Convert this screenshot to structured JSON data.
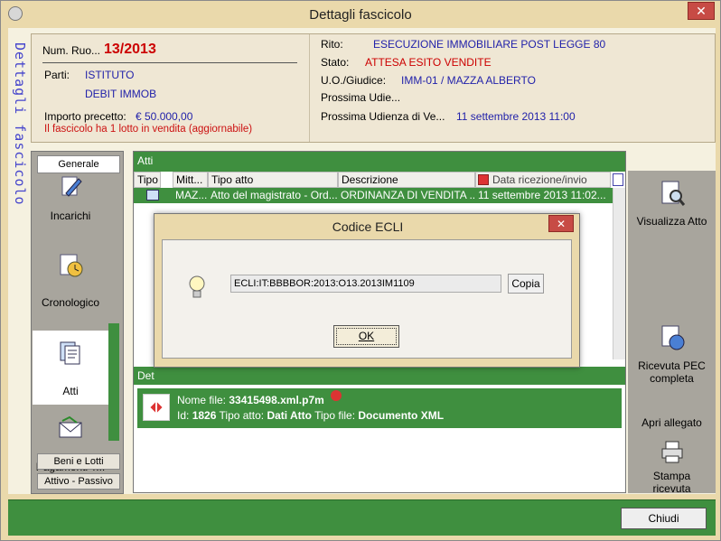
{
  "window": {
    "title": "Dettagli fascicolo",
    "close_glyph": "✕"
  },
  "side_label": "Dettagli fascicolo",
  "header": {
    "num_ruolo_label": "Num. Ruo...",
    "num_ruolo_value": "13/2013",
    "parti_label": "Parti:",
    "parti_line1": "ISTITUTO",
    "parti_line2": "DEBIT IMMOB",
    "importo_label": "Importo precetto:",
    "importo_value": "€ 50.000,00",
    "lotto_note": "Il fascicolo ha 1 lotto in vendita (aggiornabile)",
    "rito_label": "Rito:",
    "rito_value": "ESECUZIONE IMMOBILIARE POST LEGGE 80",
    "stato_label": "Stato:",
    "stato_value": "ATTESA ESITO VENDITE",
    "uo_label": "U.O./Giudice:",
    "uo_value": "IMM-01 / MAZZA ALBERTO",
    "prossima_udie_label": "Prossima Udie...",
    "prossima_udienza_label": "Prossima Udienza di Ve...",
    "prossima_udienza_value": "11 settembre 2013 11:00"
  },
  "left_nav": {
    "tab_generale": "Generale",
    "items": [
      {
        "label": "Incarichi",
        "icon": "pencil-document-icon"
      },
      {
        "label": "Cronologico",
        "icon": "clock-document-icon"
      },
      {
        "label": "Atti",
        "icon": "documents-icon"
      },
      {
        "label": "Pagamenti T...",
        "icon": "envelope-icon"
      }
    ],
    "btn_beni": "Beni e Lotti",
    "btn_attivo": "Attivo - Passivo"
  },
  "atti": {
    "header": "Atti",
    "columns": [
      "Tipo",
      "Mitt...",
      "Tipo atto",
      "Descrizione",
      "Data ricezione/invio"
    ],
    "row": {
      "mitt": "MAZ...",
      "tipo_atto": "Atto del magistrato - Ord...",
      "descrizione": "ORDINANZA DI VENDITA ...",
      "data": "11 settembre 2013 11:02..."
    },
    "details_header": "Det",
    "detail_file_label": "Nome file:",
    "detail_file_value": "33415498.xml.p7m",
    "detail_id_label": "Id:",
    "detail_id_value": "1826",
    "detail_tipo_label": "Tipo atto:",
    "detail_tipo_value": "Dati Atto",
    "detail_tipofile_label": "Tipo file:",
    "detail_tipofile_value": "Documento XML"
  },
  "right_panel": {
    "visualizza": "Visualizza Atto",
    "ricevuta_line1": "Ricevuta PEC",
    "ricevuta_line2": "completa",
    "apri": "Apri allegato",
    "stampa_line1": "Stampa",
    "stampa_line2": "ricevuta"
  },
  "footer": {
    "chiudi": "Chiudi"
  },
  "dialog": {
    "title": "Codice ECLI",
    "close_glyph": "✕",
    "ecli_value": "ECLI:IT:BBBBOR:2013:O13.2013IM1109",
    "copia": "Copia",
    "ok": "OK"
  },
  "colors": {
    "green": "#3f8f3f",
    "beige": "#ead9ab",
    "accent_red": "#cc0000",
    "link_blue": "#2222aa"
  }
}
